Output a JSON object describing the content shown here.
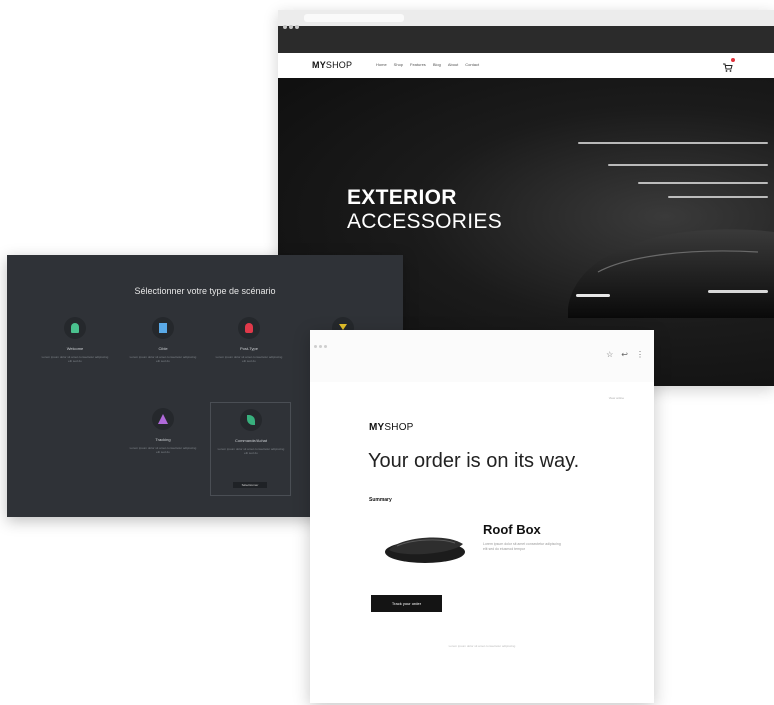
{
  "shop_window": {
    "logo_bold": "MY",
    "logo_rest": "SHOP",
    "nav_items": [
      "Home",
      "Shop",
      "Features",
      "Blog",
      "About",
      "Contact"
    ],
    "hero": {
      "title_line1": "EXTERIOR",
      "title_line2": "ACCESSORIES"
    }
  },
  "scenario_window": {
    "heading": "Sélectionner votre type de scénario",
    "items": [
      {
        "label": "Welcome",
        "desc": "Lorem ipsum dolor sit amet consectetur adipiscing elit sed do",
        "color": "#4ac18e",
        "icon": "person-icon"
      },
      {
        "label": "Cible",
        "desc": "Lorem ipsum dolor sit amet consectetur adipiscing elit sed do",
        "color": "#5aa9e6",
        "icon": "building-icon"
      },
      {
        "label": "Post-Type",
        "desc": "Lorem ipsum dolor sit amet consectetur adipiscing elit sed do",
        "color": "#e0394a",
        "icon": "flame-icon"
      },
      {
        "label": "Tracking",
        "desc": "Lorem ipsum dolor sit amet consectetur adipiscing elit sed do",
        "color": "#b069d9",
        "icon": "cone-icon"
      },
      {
        "label": "Commande/Achat",
        "desc": "Lorem ipsum dolor sit amet consectetur adipiscing elit sed do",
        "color": "#38b07d",
        "icon": "leaf-icon"
      }
    ],
    "selected_button": "Sélectionner"
  },
  "mail_window": {
    "top_small": "View online",
    "logo_bold": "MY",
    "logo_rest": "SHOP",
    "headline": "Your order is on its way.",
    "summary_label": "Summary",
    "product_name": "Roof Box",
    "product_desc": "Lorem ipsum dolor sit amet consectetur adipiscing elit sed do eiusmod tempor",
    "track_button": "Track your order",
    "footer": "Lorem ipsum dolor sit amet consectetur adipiscing",
    "tools": [
      "star-icon",
      "reply-icon",
      "more-icon"
    ]
  }
}
